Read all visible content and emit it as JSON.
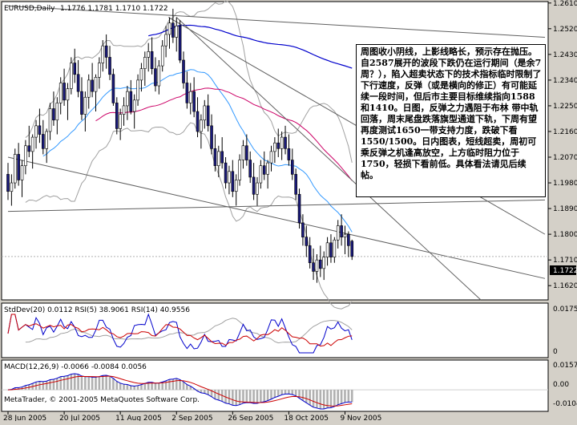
{
  "chart_data": [
    {
      "type": "candlestick",
      "title": "EURUSD,Daily",
      "ohlc_label": "1.1776 1.1781 1.1710 1.1722",
      "last_price_label": "1.1722",
      "last_price": 1.1722,
      "ylim": [
        1.157,
        1.2615
      ],
      "y_tick_labels": [
        "1.2610",
        "1.2520",
        "1.2430",
        "1.2340",
        "1.2250",
        "1.2160",
        "1.2070",
        "1.1980",
        "1.1890",
        "1.1800",
        "1.1710",
        "1.1620"
      ],
      "y_ticks": [
        1.261,
        1.252,
        1.243,
        1.234,
        1.225,
        1.216,
        1.207,
        1.198,
        1.189,
        1.18,
        1.171,
        1.162
      ],
      "x_tick_labels": [
        "28 Jun 2005",
        "20 Jul 2005",
        "11 Aug 2005",
        "2 Sep 2005",
        "26 Sep 2005",
        "18 Oct 2005",
        "9 Nov 2005"
      ],
      "x_tick_index": [
        0,
        16,
        32,
        48,
        64,
        80,
        96
      ],
      "candles": [
        [
          1.201,
          1.205,
          1.192,
          1.195
        ],
        [
          1.195,
          1.201,
          1.19,
          1.198
        ],
        [
          1.198,
          1.21,
          1.196,
          1.208
        ],
        [
          1.208,
          1.212,
          1.197,
          1.199
        ],
        [
          1.199,
          1.206,
          1.193,
          1.204
        ],
        [
          1.204,
          1.213,
          1.201,
          1.211
        ],
        [
          1.211,
          1.218,
          1.207,
          1.209
        ],
        [
          1.209,
          1.215,
          1.203,
          1.214
        ],
        [
          1.214,
          1.22,
          1.21,
          1.218
        ],
        [
          1.218,
          1.224,
          1.212,
          1.215
        ],
        [
          1.215,
          1.22,
          1.208,
          1.21
        ],
        [
          1.21,
          1.217,
          1.205,
          1.216
        ],
        [
          1.216,
          1.226,
          1.213,
          1.224
        ],
        [
          1.224,
          1.23,
          1.218,
          1.22
        ],
        [
          1.22,
          1.228,
          1.215,
          1.226
        ],
        [
          1.226,
          1.235,
          1.222,
          1.233
        ],
        [
          1.233,
          1.238,
          1.225,
          1.227
        ],
        [
          1.227,
          1.233,
          1.22,
          1.231
        ],
        [
          1.231,
          1.242,
          1.229,
          1.24
        ],
        [
          1.24,
          1.245,
          1.233,
          1.236
        ],
        [
          1.236,
          1.241,
          1.228,
          1.23
        ],
        [
          1.23,
          1.235,
          1.22,
          1.222
        ],
        [
          1.222,
          1.23,
          1.216,
          1.228
        ],
        [
          1.228,
          1.236,
          1.224,
          1.234
        ],
        [
          1.234,
          1.24,
          1.228,
          1.23
        ],
        [
          1.23,
          1.236,
          1.223,
          1.235
        ],
        [
          1.235,
          1.242,
          1.231,
          1.24
        ],
        [
          1.24,
          1.248,
          1.237,
          1.246
        ],
        [
          1.246,
          1.25,
          1.238,
          1.242
        ],
        [
          1.242,
          1.246,
          1.234,
          1.236
        ],
        [
          1.236,
          1.238,
          1.225,
          1.226
        ],
        [
          1.226,
          1.228,
          1.215,
          1.217
        ],
        [
          1.217,
          1.224,
          1.213,
          1.222
        ],
        [
          1.222,
          1.228,
          1.218,
          1.225
        ],
        [
          1.225,
          1.232,
          1.22,
          1.23
        ],
        [
          1.23,
          1.234,
          1.222,
          1.223
        ],
        [
          1.223,
          1.229,
          1.217,
          1.227
        ],
        [
          1.227,
          1.236,
          1.225,
          1.234
        ],
        [
          1.234,
          1.24,
          1.23,
          1.238
        ],
        [
          1.238,
          1.244,
          1.232,
          1.242
        ],
        [
          1.242,
          1.247,
          1.237,
          1.244
        ],
        [
          1.244,
          1.249,
          1.236,
          1.238
        ],
        [
          1.238,
          1.242,
          1.23,
          1.232
        ],
        [
          1.232,
          1.241,
          1.229,
          1.239
        ],
        [
          1.239,
          1.248,
          1.237,
          1.246
        ],
        [
          1.246,
          1.253,
          1.242,
          1.25
        ],
        [
          1.25,
          1.256,
          1.245,
          1.254
        ],
        [
          1.254,
          1.259,
          1.247,
          1.249
        ],
        [
          1.249,
          1.256,
          1.244,
          1.253
        ],
        [
          1.253,
          1.255,
          1.24,
          1.241
        ],
        [
          1.241,
          1.244,
          1.231,
          1.233
        ],
        [
          1.233,
          1.237,
          1.224,
          1.226
        ],
        [
          1.226,
          1.233,
          1.222,
          1.23
        ],
        [
          1.23,
          1.235,
          1.221,
          1.223
        ],
        [
          1.223,
          1.228,
          1.214,
          1.216
        ],
        [
          1.216,
          1.222,
          1.21,
          1.22
        ],
        [
          1.22,
          1.227,
          1.217,
          1.225
        ],
        [
          1.225,
          1.229,
          1.216,
          1.218
        ],
        [
          1.218,
          1.222,
          1.208,
          1.21
        ],
        [
          1.21,
          1.215,
          1.202,
          1.204
        ],
        [
          1.204,
          1.211,
          1.2,
          1.209
        ],
        [
          1.209,
          1.214,
          1.203,
          1.205
        ],
        [
          1.205,
          1.207,
          1.196,
          1.198
        ],
        [
          1.198,
          1.204,
          1.194,
          1.202
        ],
        [
          1.202,
          1.206,
          1.193,
          1.195
        ],
        [
          1.195,
          1.201,
          1.19,
          1.199
        ],
        [
          1.199,
          1.208,
          1.197,
          1.206
        ],
        [
          1.206,
          1.213,
          1.203,
          1.211
        ],
        [
          1.211,
          1.215,
          1.204,
          1.206
        ],
        [
          1.206,
          1.209,
          1.198,
          1.2
        ],
        [
          1.2,
          1.205,
          1.192,
          1.194
        ],
        [
          1.194,
          1.2,
          1.19,
          1.198
        ],
        [
          1.198,
          1.206,
          1.196,
          1.204
        ],
        [
          1.204,
          1.209,
          1.199,
          1.201
        ],
        [
          1.201,
          1.206,
          1.196,
          1.205
        ],
        [
          1.205,
          1.211,
          1.202,
          1.209
        ],
        [
          1.209,
          1.214,
          1.205,
          1.212
        ],
        [
          1.212,
          1.217,
          1.207,
          1.21
        ],
        [
          1.21,
          1.216,
          1.206,
          1.214
        ],
        [
          1.214,
          1.218,
          1.208,
          1.21
        ],
        [
          1.21,
          1.215,
          1.204,
          1.206
        ],
        [
          1.206,
          1.21,
          1.199,
          1.201
        ],
        [
          1.201,
          1.203,
          1.192,
          1.194
        ],
        [
          1.194,
          1.196,
          1.182,
          1.184
        ],
        [
          1.184,
          1.187,
          1.176,
          1.179
        ],
        [
          1.179,
          1.183,
          1.172,
          1.176
        ],
        [
          1.176,
          1.179,
          1.168,
          1.17
        ],
        [
          1.17,
          1.175,
          1.164,
          1.167
        ],
        [
          1.167,
          1.173,
          1.163,
          1.171
        ],
        [
          1.171,
          1.176,
          1.165,
          1.168
        ],
        [
          1.168,
          1.174,
          1.164,
          1.172
        ],
        [
          1.172,
          1.179,
          1.169,
          1.177
        ],
        [
          1.177,
          1.18,
          1.17,
          1.172
        ],
        [
          1.172,
          1.179,
          1.17,
          1.178
        ],
        [
          1.178,
          1.185,
          1.175,
          1.183
        ],
        [
          1.183,
          1.187,
          1.176,
          1.179
        ],
        [
          1.179,
          1.183,
          1.173,
          1.18
        ],
        [
          1.18,
          1.181,
          1.172,
          1.176
        ],
        [
          1.1776,
          1.1781,
          1.171,
          1.1722
        ]
      ],
      "colors": {
        "bull_body": "#ffffff",
        "bear_body": "#1a1a7a",
        "wick": "#000000",
        "ma_slow": "#0000cc",
        "ma_mid": "#3399ff",
        "ma_fast": "#cc0066",
        "bands": "#a0a0a0",
        "trendline": "#606060",
        "background": "#ffffff"
      },
      "annotation": "周图收小阴线，上影线略长，预示存在抛压。自2587展开的波段下跌仍在运行期间（是余7周？），陷入超卖状态下的技术指标临时限制了下行速度，反弹（或是横向的修正）有可能延续一段时间，但后市主要目标维续指向1588和1410。日图，反弹之力遇阻于布林 带中轨回落，周末尾盘跌落旗型通道下轨，下周有望再度测试1650一带支持力度，跌破下看1550/1500。日内图表，短线超卖，周初可乘反弹之机逢高放空，上方临时阻力位于1750，轻损下看前低。具体看法请见后续帖。"
    },
    {
      "type": "line",
      "title": "StdDev(20) 0.0112  RSI(5) 38.9061  RSI(14) 40.9556",
      "y_tick_labels": [
        "0.0175",
        "0"
      ],
      "ylim": [
        0,
        0.0175
      ],
      "series": [
        {
          "name": "StdDev(20)",
          "color": "#a0a0a0"
        },
        {
          "name": "RSI(5)",
          "color": "#0000cc"
        },
        {
          "name": "RSI(14)",
          "color": "#cc0000"
        }
      ]
    },
    {
      "type": "bar",
      "title": "MACD(12,26,9) -0.0066 -0.0084 0.0056",
      "y_tick_labels": [
        "0.0157",
        "0.00",
        "-0.0104"
      ],
      "ylim": [
        -0.0104,
        0.0157
      ],
      "series": [
        {
          "name": "MACD histogram",
          "color": "#b0b0b0"
        },
        {
          "name": "MACD",
          "color": "#0000cc"
        },
        {
          "name": "Signal",
          "color": "#cc0000"
        }
      ],
      "footer": "MetaTrader, © 2001-2005 MetaQuotes Software Corp."
    }
  ]
}
